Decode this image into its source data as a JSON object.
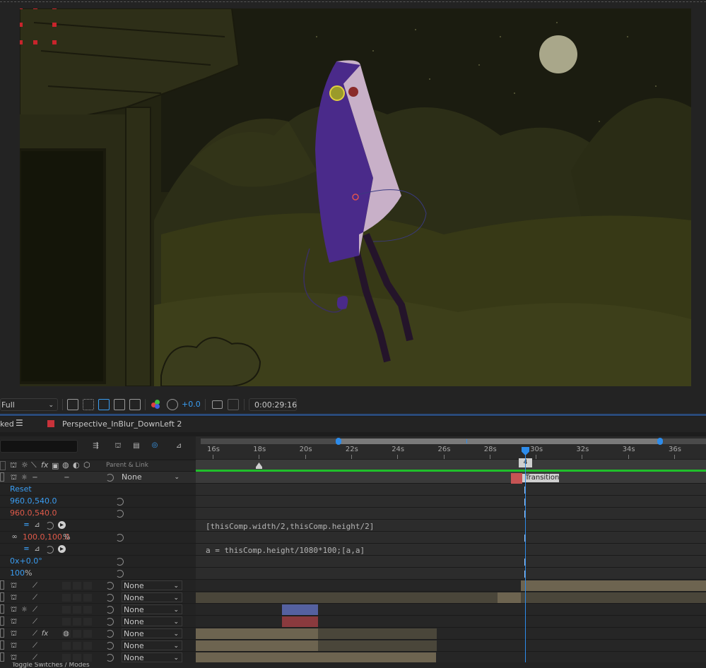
{
  "viewer": {
    "resolution_label": "Full",
    "exposure_value": "+0.0",
    "timecode": "0:00:29:16"
  },
  "timeline": {
    "panel_tab_partial": "ked",
    "comp_name": "Perspective_InBlur_DownLeft 2",
    "comp_color": "#c8323a",
    "parent_link_header": "Parent & Link",
    "ruler_labels": [
      "16s",
      "18s",
      "20s",
      "22s",
      "24s",
      "26s",
      "28s",
      "30s",
      "32s",
      "34s",
      "36s"
    ],
    "playhead_marker": "4",
    "marker_label": "Transition",
    "toggle_text": "Toggle Switches / Modes"
  },
  "properties": {
    "reset_label": "Reset",
    "anchor_point": "960.0,540.0",
    "position": "960.0,540.0",
    "scale": "100.0,100.0",
    "scale_unit": "%",
    "rotation": "0x+0.0°",
    "opacity": "100",
    "opacity_unit": "%",
    "none_label": "None"
  },
  "expressions": {
    "position_expr": "[thisComp.width/2,thisComp.height/2]",
    "scale_expr": "a = thisComp.height/1080*100;[a,a]"
  },
  "layer_colors": {
    "tan": "#6d6450",
    "blue": "#5561a0",
    "red": "#8a3a3e",
    "marker_red": "#c65454"
  }
}
